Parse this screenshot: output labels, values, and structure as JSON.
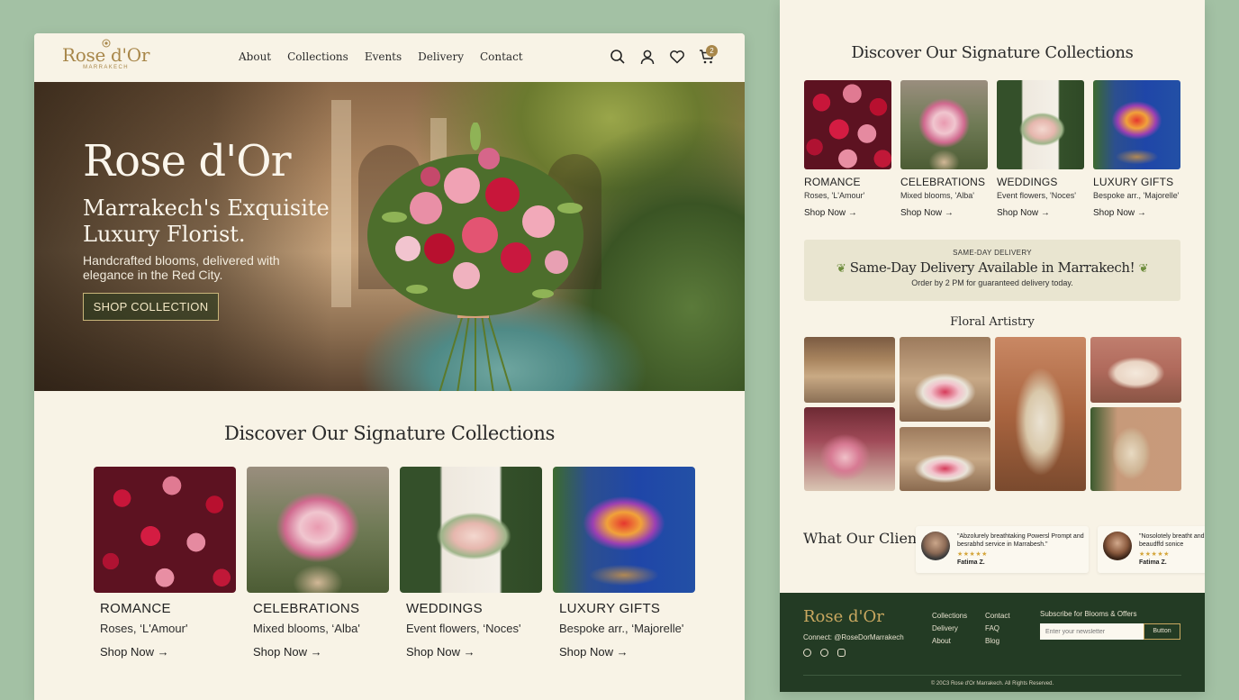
{
  "brand": {
    "name": "Rose d'Or",
    "city": "MARRAKECH"
  },
  "nav": {
    "links": [
      "About",
      "Collections",
      "Events",
      "Delivery",
      "Contact"
    ],
    "cart_count": "2"
  },
  "hero": {
    "title": "Rose d'Or",
    "subtitle": "Marrakech's Exquisite Luxury Florist.",
    "description": "Handcrafted blooms, delivered with elegance in the Red City.",
    "cta": "SHOP COLLECTION"
  },
  "collections": {
    "title": "Discover Our Signature Collections",
    "items": [
      {
        "title": "ROMANCE",
        "subtitle": "Roses, ‘L'Amour'",
        "cta": "Shop Now →"
      },
      {
        "title": "CELEBRATIONS",
        "subtitle": "Mixed blooms, ‘Alba'",
        "cta": "Shop Now →"
      },
      {
        "title": "WEDDINGS",
        "subtitle": "Event flowers, ‘Noces'",
        "cta": "Shop Now →"
      },
      {
        "title": "LUXURY GIFTS",
        "subtitle": "Bespoke arr., ‘Majorelle'",
        "cta": "Shop Now →"
      }
    ]
  },
  "right_page": {
    "collections_title": "Discover Our Signature Collections",
    "items": [
      {
        "title": "ROMANCE",
        "subtitle": "Roses, 'L'Amour'",
        "cta": "Shop Now →"
      },
      {
        "title": "CELEBRATIONS",
        "subtitle": "Mixed blooms, 'Alba'",
        "cta": "Shop Now →"
      },
      {
        "title": "WEDDINGS",
        "subtitle": "Event flowers, 'Noces'",
        "cta": "Shop Now →"
      },
      {
        "title": "LUXURY GIFTS",
        "subtitle": "Bespoke arr., 'Majorelle'",
        "cta": "Shop Now →"
      }
    ],
    "delivery": {
      "label": "SAME-DAY DELIVERY",
      "headline": "Same-Day Delivery Available in Marrakech!",
      "note": "Order by 2 PM for guaranteed delivery today."
    },
    "artistry_title": "Floral Artistry",
    "testimonials": {
      "title": "What Our Clients Say",
      "items": [
        {
          "quote": "\"Abzolurely breathtaking Powersl Prompt and besrabhd service in Marrabesh.\"",
          "stars": "★★★★★",
          "name": "Fatima Z."
        },
        {
          "quote": "\"Nosolotely breatht and beaudffd sonice",
          "stars": "★★★★★",
          "name": "Fatima Z."
        }
      ]
    },
    "footer": {
      "logo": "Rose d'Or",
      "connect": "Connect: @RoseDorMarrakech",
      "col1": [
        "Collections",
        "Delivery",
        "About"
      ],
      "col2": [
        "Contact",
        "FAQ",
        "Blog"
      ],
      "subscribe_title": "Subscribe for Blooms & Offers",
      "newsletter_placeholder": "Enter your newsletter",
      "button": "Button",
      "copyright": "© 20C3 Rose d'Or Marrakech. All Rights Reserved."
    }
  },
  "colors": {
    "background": "#a3c1a4",
    "cream": "#f8f3e6",
    "gold": "#a8874a",
    "footer_green": "#233b24"
  },
  "icons": [
    "search-icon",
    "user-icon",
    "heart-icon",
    "cart-icon",
    "arrow-right-icon",
    "leaf-icon",
    "facebook-icon",
    "pinterest-icon",
    "instagram-icon"
  ]
}
